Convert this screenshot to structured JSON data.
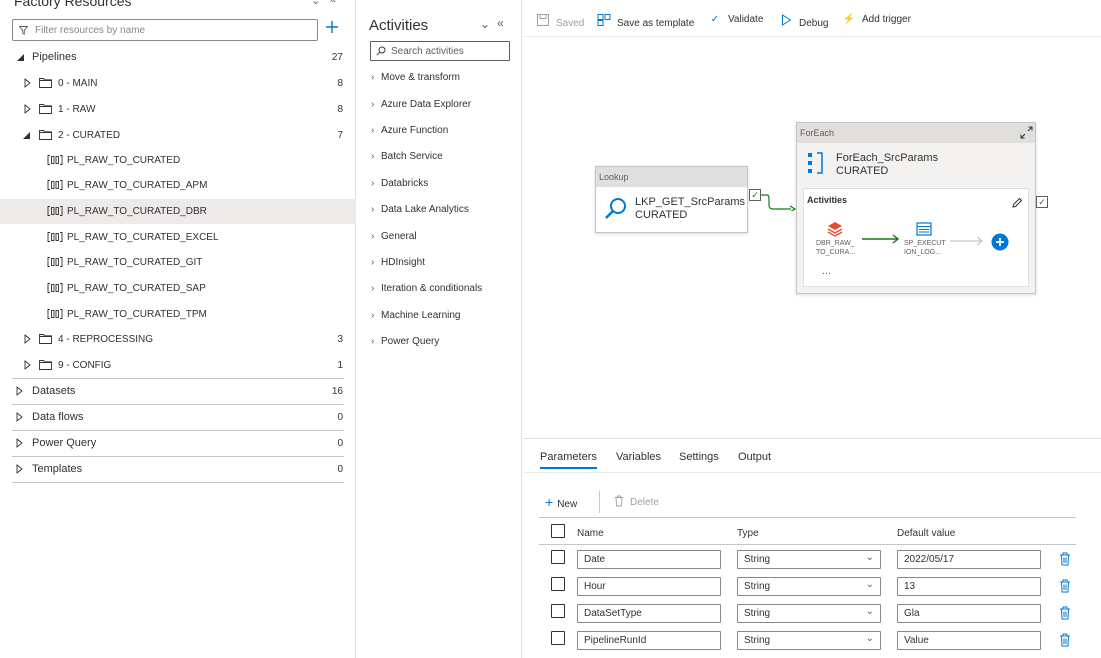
{
  "factory": {
    "title": "Factory Resources",
    "filter_placeholder": "Filter resources by name",
    "pipelines": {
      "label": "Pipelines",
      "count": "27"
    },
    "folders": [
      {
        "label": "0 - MAIN",
        "count": "8"
      },
      {
        "label": "1 - RAW",
        "count": "8"
      },
      {
        "label": "2 - CURATED",
        "count": "7"
      }
    ],
    "curated_pipelines": [
      "PL_RAW_TO_CURATED",
      "PL_RAW_TO_CURATED_APM",
      "PL_RAW_TO_CURATED_DBR",
      "PL_RAW_TO_CURATED_EXCEL",
      "PL_RAW_TO_CURATED_GIT",
      "PL_RAW_TO_CURATED_SAP",
      "PL_RAW_TO_CURATED_TPM"
    ],
    "folders_after": [
      {
        "label": "4 - REPROCESSING",
        "count": "3"
      },
      {
        "label": "9 - CONFIG",
        "count": "1"
      }
    ],
    "sections": [
      {
        "label": "Datasets",
        "count": "16"
      },
      {
        "label": "Data flows",
        "count": "0"
      },
      {
        "label": "Power Query",
        "count": "0"
      },
      {
        "label": "Templates",
        "count": "0"
      }
    ]
  },
  "activities": {
    "title": "Activities",
    "search_placeholder": "Search activities",
    "categories": [
      "Move & transform",
      "Azure Data Explorer",
      "Azure Function",
      "Batch Service",
      "Databricks",
      "Data Lake Analytics",
      "General",
      "HDInsight",
      "Iteration & conditionals",
      "Machine Learning",
      "Power Query"
    ]
  },
  "toolbar": {
    "saved": "Saved",
    "save_template": "Save as template",
    "validate": "Validate",
    "debug": "Debug",
    "add_trigger": "Add trigger"
  },
  "canvas": {
    "lookup": {
      "type": "Lookup",
      "name": "LKP_GET_SrcParams",
      "sub": "CURATED"
    },
    "foreach": {
      "type": "ForEach",
      "name": "ForEach_SrcParams",
      "sub": "CURATED",
      "inner_title": "Activities",
      "inner_a1_line1": "DBR_RAW_",
      "inner_a1_line2": "TO_CURA...",
      "inner_a2_line1": "SP_EXECUT",
      "inner_a2_line2": "ION_LOG...",
      "more": "..."
    }
  },
  "bottom": {
    "tabs": [
      "Parameters",
      "Variables",
      "Settings",
      "Output"
    ],
    "new_label": "New",
    "delete_label": "Delete",
    "columns": {
      "name": "Name",
      "type": "Type",
      "default": "Default value"
    },
    "params": [
      {
        "name": "Date",
        "type": "String",
        "default": "2022/05/17"
      },
      {
        "name": "Hour",
        "type": "String",
        "default": "13"
      },
      {
        "name": "DataSetType",
        "type": "String",
        "default": "Gla"
      },
      {
        "name": "PipelineRunId",
        "type": "String",
        "default": "Value"
      }
    ]
  },
  "colors": {
    "accent": "#0078d4",
    "success": "#107c10",
    "node_header": "#e1dfdd"
  }
}
